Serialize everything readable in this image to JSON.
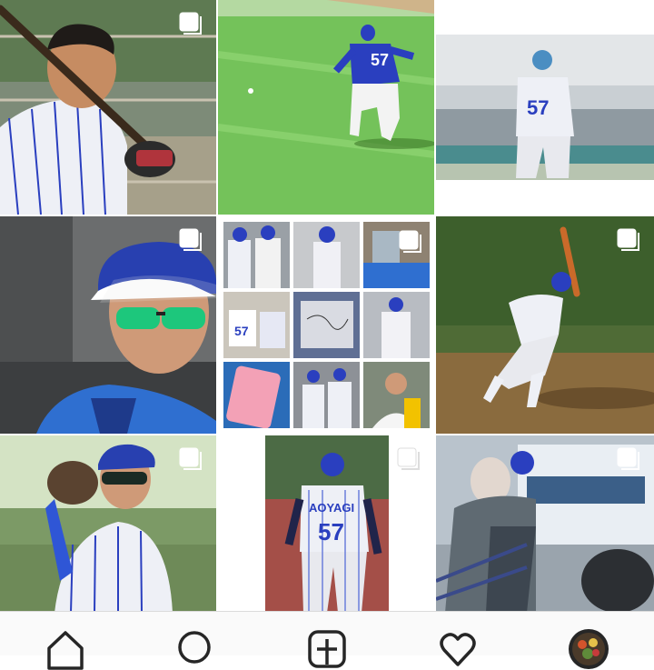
{
  "feed": {
    "posts": [
      {
        "id_label": "Batter with bat in pinstripe uniform",
        "multi": true
      },
      {
        "id_label": "Fielder running on grass",
        "multi": false
      },
      {
        "id_label": "Player 57 back view",
        "multi": false
      },
      {
        "id_label": "Close-up with sunglasses",
        "multi": true
      },
      {
        "id_label": "Collage of nine photos",
        "multi": true
      },
      {
        "id_label": "Player hitting in stadium",
        "multi": true
      },
      {
        "id_label": "Player with glove",
        "multi": true
      },
      {
        "id_label": "Player AOYAGI 57 back",
        "multi": true
      },
      {
        "id_label": "Player near bus",
        "multi": true
      }
    ],
    "jersey_name": "AOYAGI",
    "jersey_number": "57"
  },
  "tabbar": {
    "items": [
      {
        "icon": "home-icon"
      },
      {
        "icon": "search-icon"
      },
      {
        "icon": "add-post-icon"
      },
      {
        "icon": "heart-icon"
      },
      {
        "icon": "profile-avatar"
      }
    ]
  },
  "colors": {
    "uniform_blue": "#2a3fbf",
    "grass_green": "#6bb54a",
    "tab_background": "#fafafa"
  }
}
